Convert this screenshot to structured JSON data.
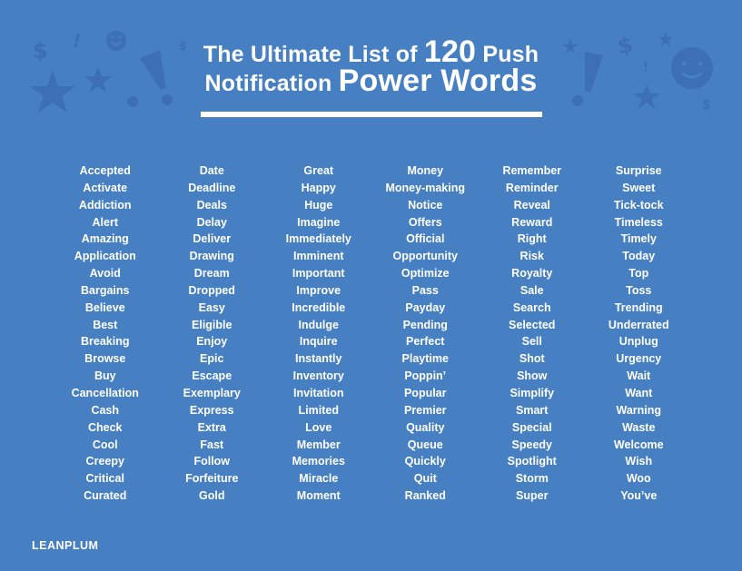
{
  "title": {
    "line1_pre": "The Ultimate List of ",
    "line1_number": "120",
    "line1_post": " Push",
    "line2_pre": "Notification ",
    "line2_big": "Power Words"
  },
  "colors": {
    "background": "#467FC2",
    "decoration": "#3C6FB3",
    "text": "#FFFFFF"
  },
  "decorations": [
    "dollar-icon",
    "exclamation-icon",
    "smiley-icon",
    "star-icon"
  ],
  "columns": [
    {
      "words": [
        "Accepted",
        "Activate",
        "Addiction",
        "Alert",
        "Amazing",
        "Application",
        "Avoid",
        "Bargains",
        "Believe",
        "Best",
        "Breaking",
        "Browse",
        "Buy",
        "Cancellation",
        "Cash",
        "Check",
        "Cool",
        "Creepy",
        "Critical",
        "Curated"
      ]
    },
    {
      "words": [
        "Date",
        "Deadline",
        "Deals",
        "Delay",
        "Deliver",
        "Drawing",
        "Dream",
        "Dropped",
        "Easy",
        "Eligible",
        "Enjoy",
        "Epic",
        "Escape",
        "Exemplary",
        "Express",
        "Extra",
        "Fast",
        "Follow",
        "Forfeiture",
        "Gold"
      ]
    },
    {
      "words": [
        "Great",
        "Happy",
        "Huge",
        "Imagine",
        "Immediately",
        "Imminent",
        "Important",
        "Improve",
        "Incredible",
        "Indulge",
        "Inquire",
        "Instantly",
        "Inventory",
        "Invitation",
        "Limited",
        "Love",
        "Member",
        "Memories",
        "Miracle",
        "Moment"
      ]
    },
    {
      "words": [
        "Money",
        "Money-making",
        "Notice",
        "Offers",
        "Official",
        "Opportunity",
        "Optimize",
        "Pass",
        "Payday",
        "Pending",
        "Perfect",
        "Playtime",
        "Poppin’",
        "Popular",
        "Premier",
        "Quality",
        "Queue",
        "Quickly",
        "Quit",
        "Ranked"
      ]
    },
    {
      "words": [
        "Remember",
        "Reminder",
        "Reveal",
        "Reward",
        "Right",
        "Risk",
        "Royalty",
        "Sale",
        "Search",
        "Selected",
        "Sell",
        "Shot",
        "Show",
        "Simplify",
        "Smart",
        "Special",
        "Speedy",
        "Spotlight",
        "Storm",
        "Super"
      ]
    },
    {
      "words": [
        "Surprise",
        "Sweet",
        "Tick-tock",
        "Timeless",
        "Timely",
        "Today",
        "Top",
        "Toss",
        "Trending",
        "Underrated",
        "Unplug",
        "Urgency",
        "Wait",
        "Want",
        "Warning",
        "Waste",
        "Welcome",
        "Wish",
        "Woo",
        "You’ve"
      ]
    }
  ],
  "footer": {
    "logo": "LEANPLUM"
  }
}
